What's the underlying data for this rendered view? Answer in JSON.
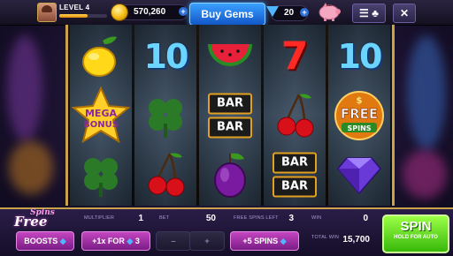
{
  "player": {
    "level_label": "LEVEL 4",
    "xp_progress": 0.6
  },
  "currency": {
    "coins": "570,260",
    "gems": "20"
  },
  "header": {
    "buy_gems_label": "Buy Gems",
    "menu_icon": "menu-icon",
    "close_icon": "close-icon"
  },
  "reels": [
    {
      "symbols": [
        "lemon",
        "mega-bonus",
        "clover"
      ]
    },
    {
      "symbols": [
        "ten",
        "clover",
        "cherries"
      ]
    },
    {
      "symbols": [
        "watermelon",
        "bar-double",
        "plum"
      ]
    },
    {
      "symbols": [
        "seven",
        "cherries",
        "bar-double"
      ]
    },
    {
      "symbols": [
        "ten",
        "free-spins",
        "diamond"
      ]
    }
  ],
  "symbol_text": {
    "bar": "BAR",
    "ten": "10",
    "seven": "7",
    "mega": "MEGA",
    "bonus": "BONUS",
    "free": "FREE",
    "spins": "SPINS",
    "dollar": "$"
  },
  "bottom": {
    "logo_top": "Spins",
    "logo_bottom": "Free",
    "multiplier_label": "MULTIPLIER",
    "multiplier_value": "1",
    "bet_label": "BET",
    "bet_value": "50",
    "free_spins_left_label": "FREE SPINS LEFT",
    "free_spins_left_value": "3",
    "win_label": "WIN",
    "win_value": "0",
    "total_win_label": "TOTAL WIN",
    "total_win_value": "15,700",
    "boosts_label": "BOOSTS",
    "multiplier_buy_label": "+1x FOR",
    "multiplier_buy_cost": "3",
    "bet_minus": "–",
    "bet_plus": "+",
    "spins_buy_label": "+5 SPINS",
    "spin_label": "SPIN",
    "spin_sub": "HOLD FOR AUTO"
  },
  "colors": {
    "accent_gold": "#c9a24a",
    "gem_blue": "#2a9bff",
    "spin_green": "#38b80a",
    "booster_pink": "#c445c0"
  }
}
